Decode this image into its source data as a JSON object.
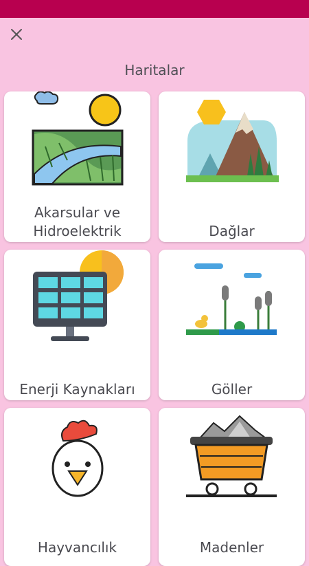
{
  "header": {
    "title": "Haritalar"
  },
  "icons": {
    "close": "close-icon"
  },
  "colors": {
    "statusbar": "#b8004f",
    "background": "#f9c4e1"
  },
  "cards": [
    {
      "label": "Akarsular ve Hidroelektrik",
      "icon": "river-landscape-icon"
    },
    {
      "label": "Dağlar",
      "icon": "mountain-icon"
    },
    {
      "label": "Enerji Kaynakları",
      "icon": "solar-panel-icon"
    },
    {
      "label": "Göller",
      "icon": "lake-icon"
    },
    {
      "label": "Hayvancılık",
      "icon": "chicken-icon"
    },
    {
      "label": "Madenler",
      "icon": "mine-cart-icon"
    }
  ]
}
